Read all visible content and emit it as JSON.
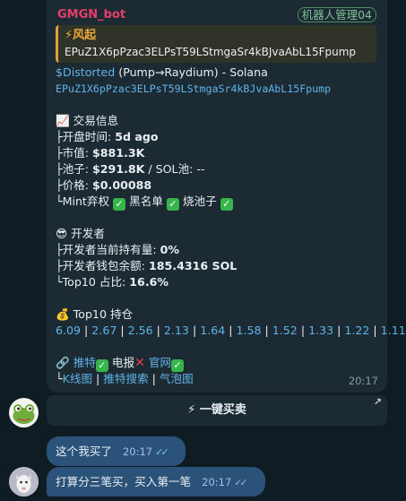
{
  "bot_message": {
    "sender": "GMGN_bot",
    "admin_tag": "机器人管理04",
    "quote": {
      "title": "⚡风起",
      "address": "EPuZ1X6pPzac3ELPsT59LStmgaSr4kBJvaAbL15Fpump"
    },
    "token_line": {
      "cashtag": "$Distorted",
      "rest": " (Pump→Raydium) - Solana"
    },
    "contract": "EPuZ1X6pPzac3ELPsT59LStmgaSr4kBJvaAbL15Fpump",
    "trade_info": {
      "header": "📈 交易信息",
      "open_time_label": "├开盘时间: ",
      "open_time_value": "5d ago",
      "market_cap_label": "├市值: ",
      "market_cap_value": "$881.3K",
      "pool_label": "├池子: ",
      "pool_value": "$291.8K",
      "pool_rest": " / SOL池: --",
      "price_label": "├价格: ",
      "price_value": "$0.00088",
      "flags": {
        "mint_label": "└Mint弃权",
        "blacklist_label": "黑名单",
        "burn_label": "烧池子"
      }
    },
    "developer": {
      "header": "😎 开发者",
      "holding_label": "├开发者当前持有量: ",
      "holding_value": "0%",
      "wallet_label": "├开发者钱包余额: ",
      "wallet_value": "185.4316 SOL",
      "top10_label": "└Top10 占比: ",
      "top10_value": "16.6%"
    },
    "top10": {
      "header": "💰 Top10 持仓",
      "values": [
        "6.09",
        "2.67",
        "2.56",
        "2.13",
        "1.64",
        "1.58",
        "1.52",
        "1.33",
        "1.22",
        "1.11"
      ]
    },
    "links_row1": {
      "link_icon": "🔗",
      "tweet": "推特",
      "report": "电报",
      "website": "官网"
    },
    "links_row2": {
      "prefix": "└",
      "kline": "K线图",
      "tweet_search": "推特搜索",
      "bubble_map": "气泡图"
    },
    "time": "20:17"
  },
  "inline_button": {
    "label": "⚡ 一键买卖",
    "arrow": "↗"
  },
  "user_messages": [
    {
      "text": "这个我买了",
      "time": "20:17"
    },
    {
      "text": "打算分三笔买，买入第一笔",
      "time": "20:17"
    }
  ],
  "colors": {
    "background": "#0f1c23",
    "bubble": "#1c2b33",
    "sender": "#e63d6b",
    "link": "#5fb3e8",
    "quote_accent": "#e1a03c",
    "outgoing": "#2b5278"
  },
  "icons": [
    "frog-avatar-icon",
    "goat-avatar-icon",
    "lightning-icon",
    "chart-icon",
    "sunglasses-icon",
    "moneybag-icon",
    "link-icon",
    "check-icon",
    "cross-icon",
    "external-arrow-icon"
  ]
}
